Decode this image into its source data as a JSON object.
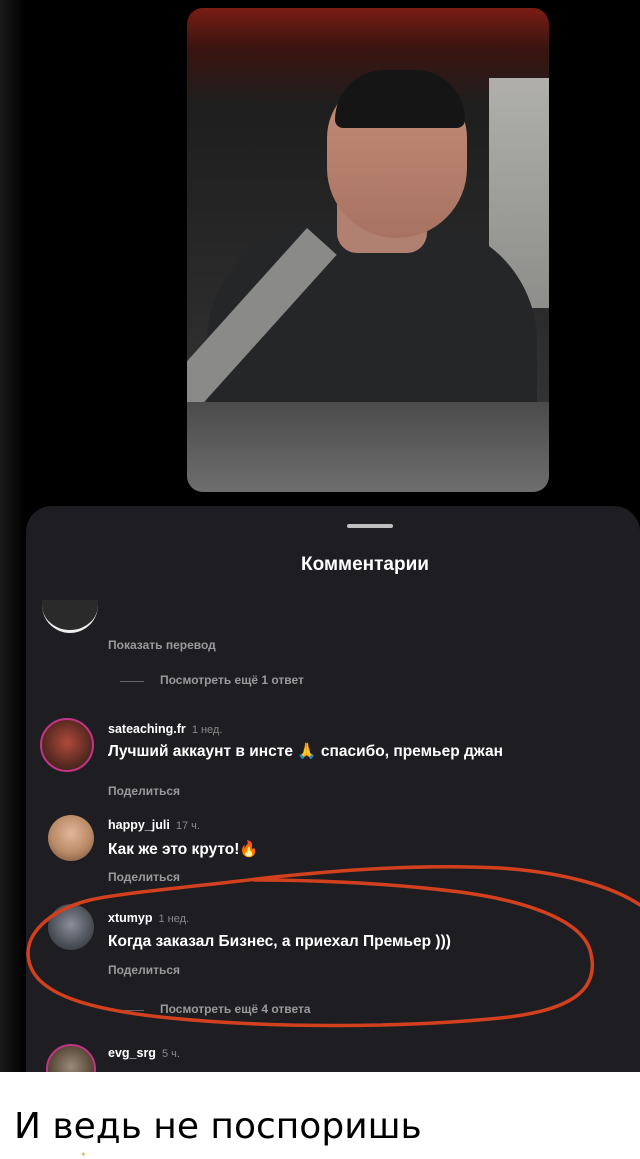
{
  "sheet": {
    "title": "Комментарии"
  },
  "thread": {
    "show_translation": "Показать перевод",
    "view_more_1": "Посмотреть ещё 1 ответ"
  },
  "comments": [
    {
      "username": "sateaching.fr",
      "time": "1 нед.",
      "text": "Лучший аккаунт в инсте",
      "emoji": "🙏",
      "text2": "спасибо, премьер джан",
      "action": "Поделиться"
    },
    {
      "username": "happy_juli",
      "time": "17 ч.",
      "text": "Как же это круто!",
      "emoji": "🔥",
      "action": "Поделиться"
    },
    {
      "username": "xtumyp",
      "time": "1 нед.",
      "text": "Когда заказал Бизнес, а приехал Премьер )))",
      "action": "Поделиться",
      "view_more": "Посмотреть ещё 4 ответа"
    },
    {
      "username": "evg_srg",
      "time": "5 ч."
    }
  ],
  "caption": "И ведь не поспоришь",
  "colors": {
    "annotation": "#d2401e",
    "sheet_bg": "#1e1e22",
    "story_ring": "#c13584"
  }
}
